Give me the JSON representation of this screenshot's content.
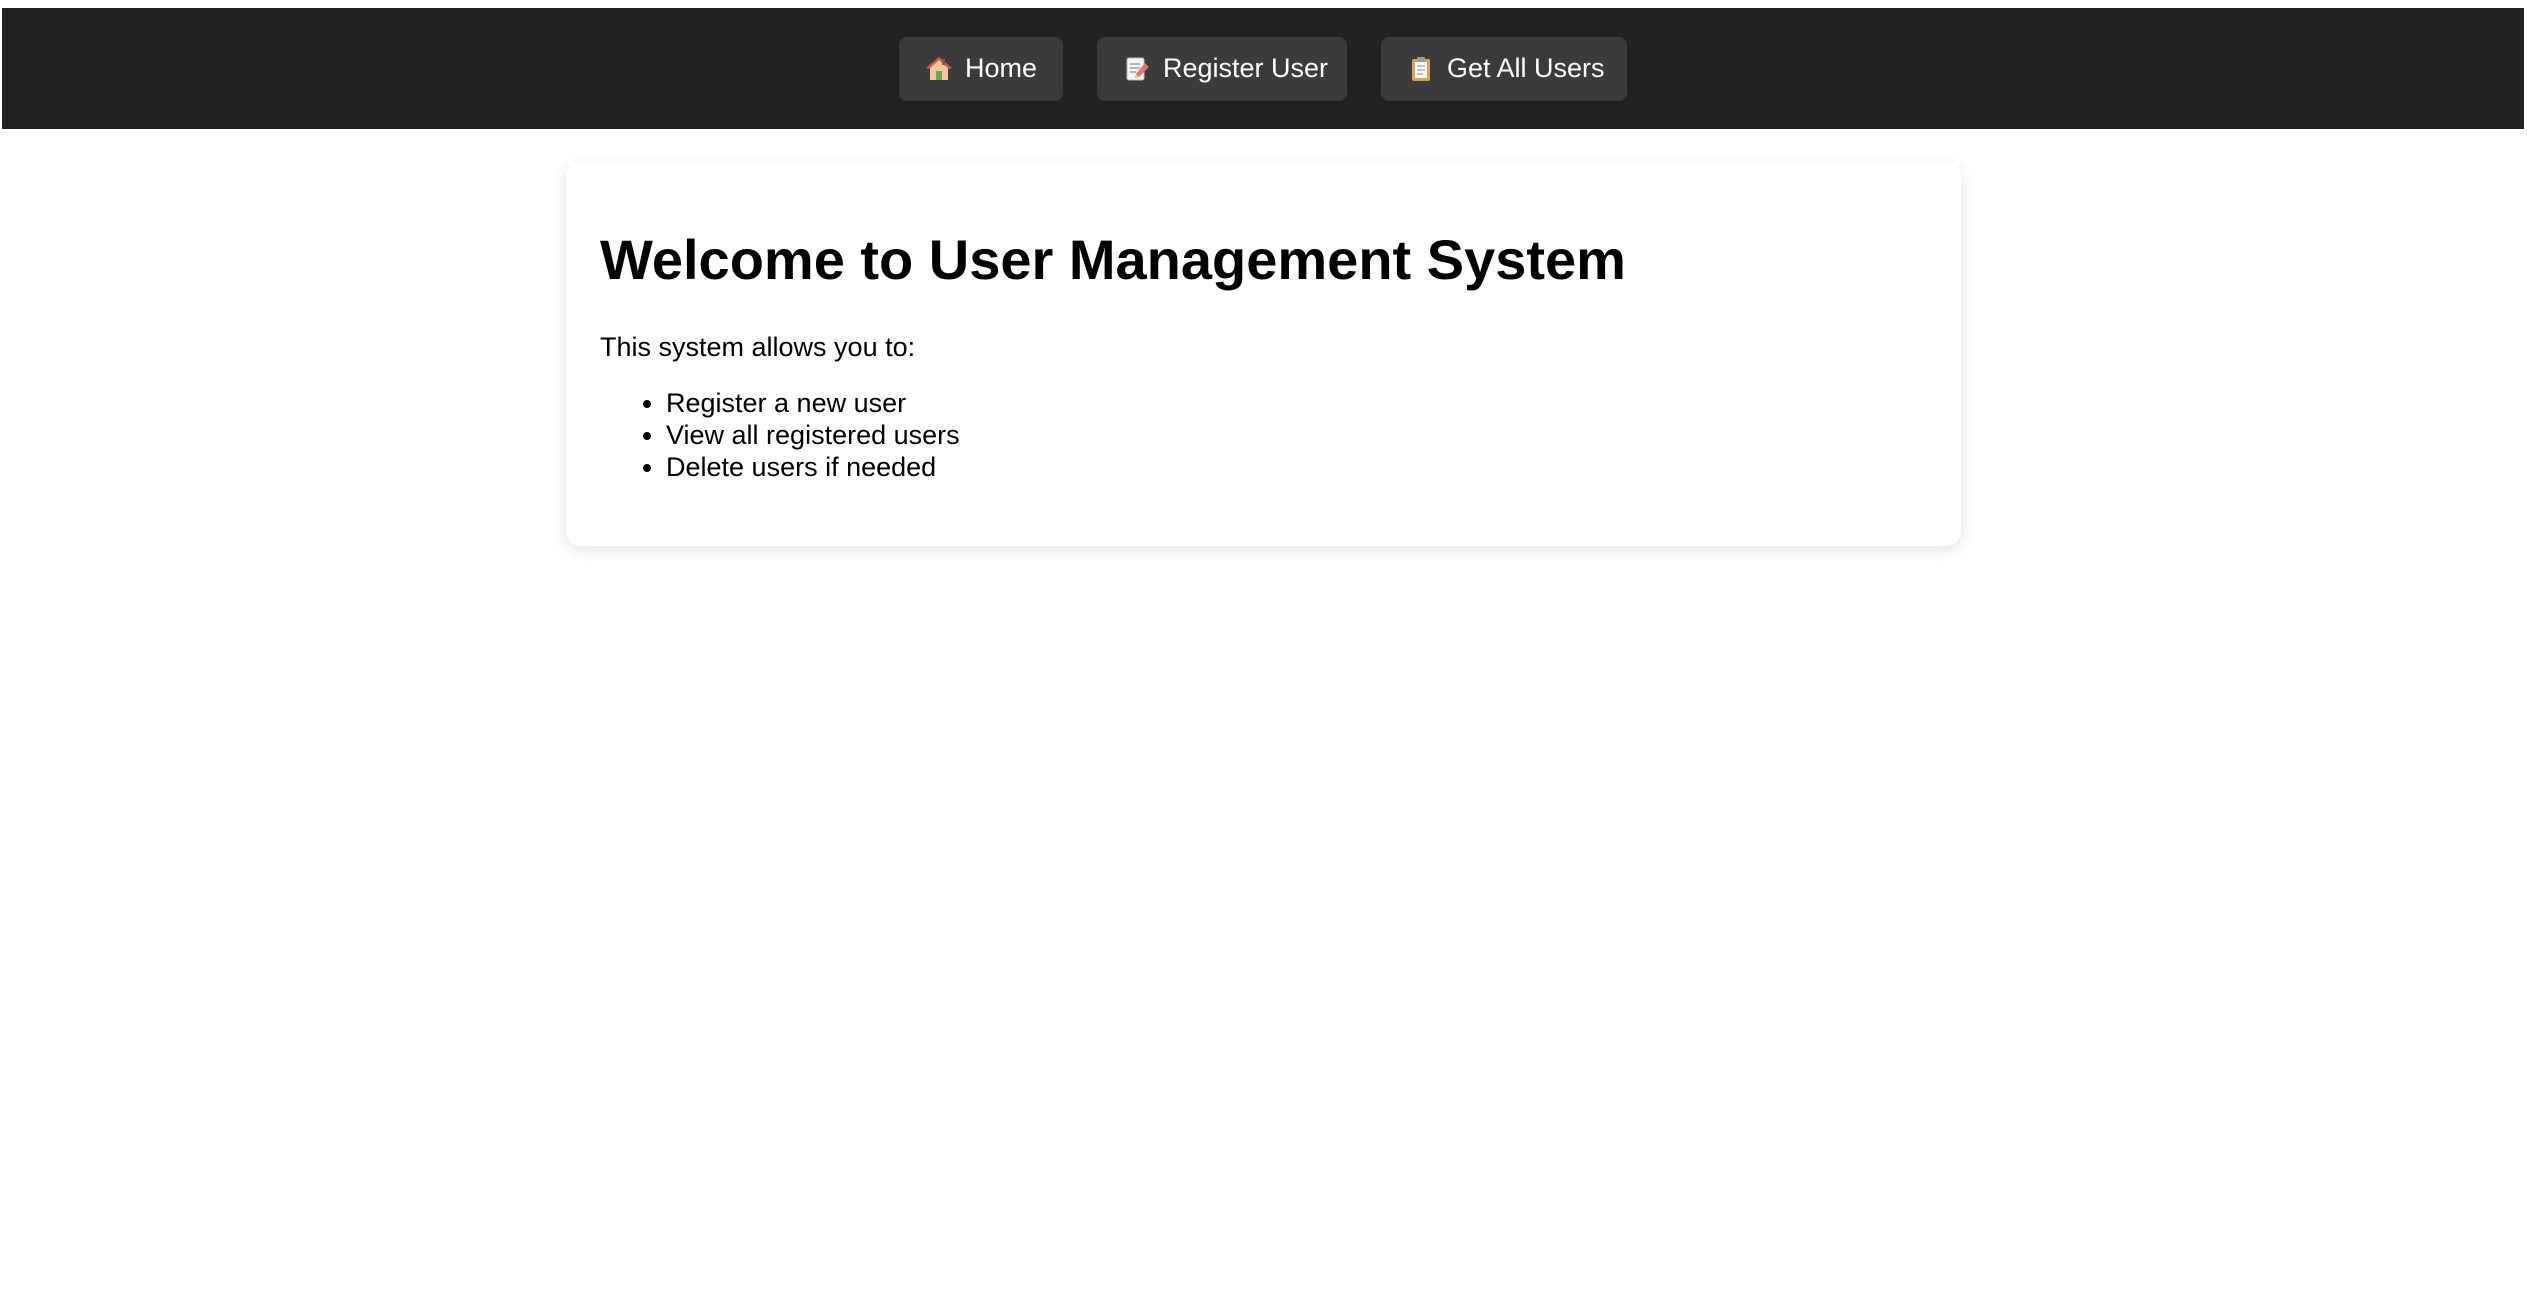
{
  "nav": {
    "items": [
      {
        "label": "Home",
        "icon": "house-icon"
      },
      {
        "label": "Register User",
        "icon": "memo-icon"
      },
      {
        "label": "Get All Users",
        "icon": "clipboard-icon"
      }
    ]
  },
  "main": {
    "title": "Welcome to User Management System",
    "intro": "This system allows you to:",
    "features": [
      "Register a new user",
      "View all registered users",
      "Delete users if needed"
    ]
  },
  "colors": {
    "navbar_bg": "#222222",
    "nav_button_bg": "#3b3b3b",
    "nav_text": "#ffffff",
    "page_bg": "#ffffff"
  }
}
